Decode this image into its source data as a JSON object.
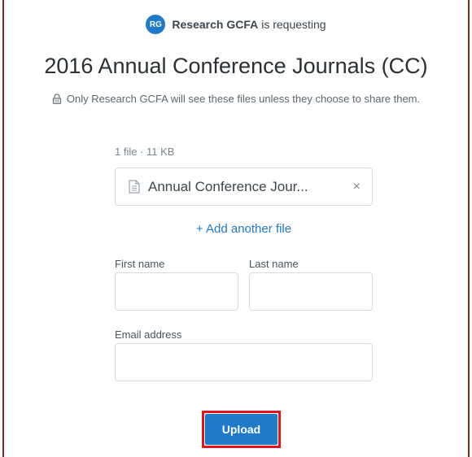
{
  "request": {
    "avatar_initials": "RG",
    "requester_name": "Research GCFA",
    "requesting_text": "is requesting",
    "title": "2016 Annual Conference Journals (CC)",
    "privacy_note": "Only Research GCFA will see these files unless they choose to share them."
  },
  "files": {
    "summary": "1 file · 11 KB",
    "items": [
      {
        "name": "Annual Conference Jour...",
        "remove_label": "×"
      }
    ],
    "add_label": "+ Add another file"
  },
  "form": {
    "first_name_label": "First name",
    "first_name_value": "",
    "last_name_label": "Last name",
    "last_name_value": "",
    "email_label": "Email address",
    "email_value": ""
  },
  "actions": {
    "upload_label": "Upload"
  },
  "colors": {
    "accent": "#1f7ac9",
    "highlight": "#e3141e",
    "frame": "#8a2a1f"
  }
}
